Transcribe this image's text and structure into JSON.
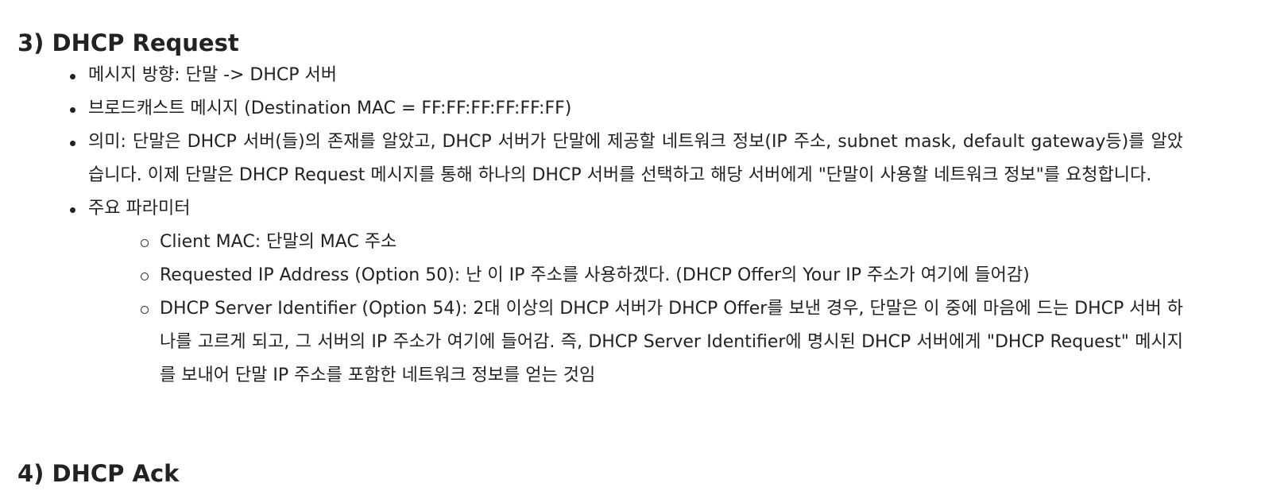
{
  "section": {
    "heading": "3) DHCP Request",
    "bullets": [
      "메시지 방향: 단말 -> DHCP 서버",
      "브로드캐스트 메시지 (Destination MAC = FF:FF:FF:FF:FF:FF)",
      "의미: 단말은 DHCP 서버(들)의 존재를 알았고, DHCP 서버가 단말에 제공할 네트워크 정보(IP 주소, subnet mask, default gateway등)를 알았습니다. 이제 단말은 DHCP Request 메시지를 통해 하나의 DHCP 서버를 선택하고 해당 서버에게 \"단말이 사용할 네트워크 정보\"를 요청합니다.",
      "주요 파라미터"
    ],
    "parameters": [
      "Client MAC: 단말의 MAC 주소",
      "Requested IP Address (Option 50): 난 이 IP 주소를 사용하겠다. (DHCP Offer의 Your IP 주소가 여기에 들어감)",
      "DHCP Server Identifier (Option 54): 2대 이상의 DHCP 서버가 DHCP Offer를 보낸 경우, 단말은 이 중에 마음에 드는 DHCP 서버 하나를 고르게 되고,  그 서버의 IP 주소가 여기에 들어감. 즉, DHCP Server Identifier에 명시된 DHCP 서버에게 \"DHCP Request\" 메시지를 보내어 단말 IP 주소를 포함한 네트워크 정보를 얻는 것임"
    ]
  },
  "next_section": {
    "heading": "4) DHCP Ack"
  }
}
